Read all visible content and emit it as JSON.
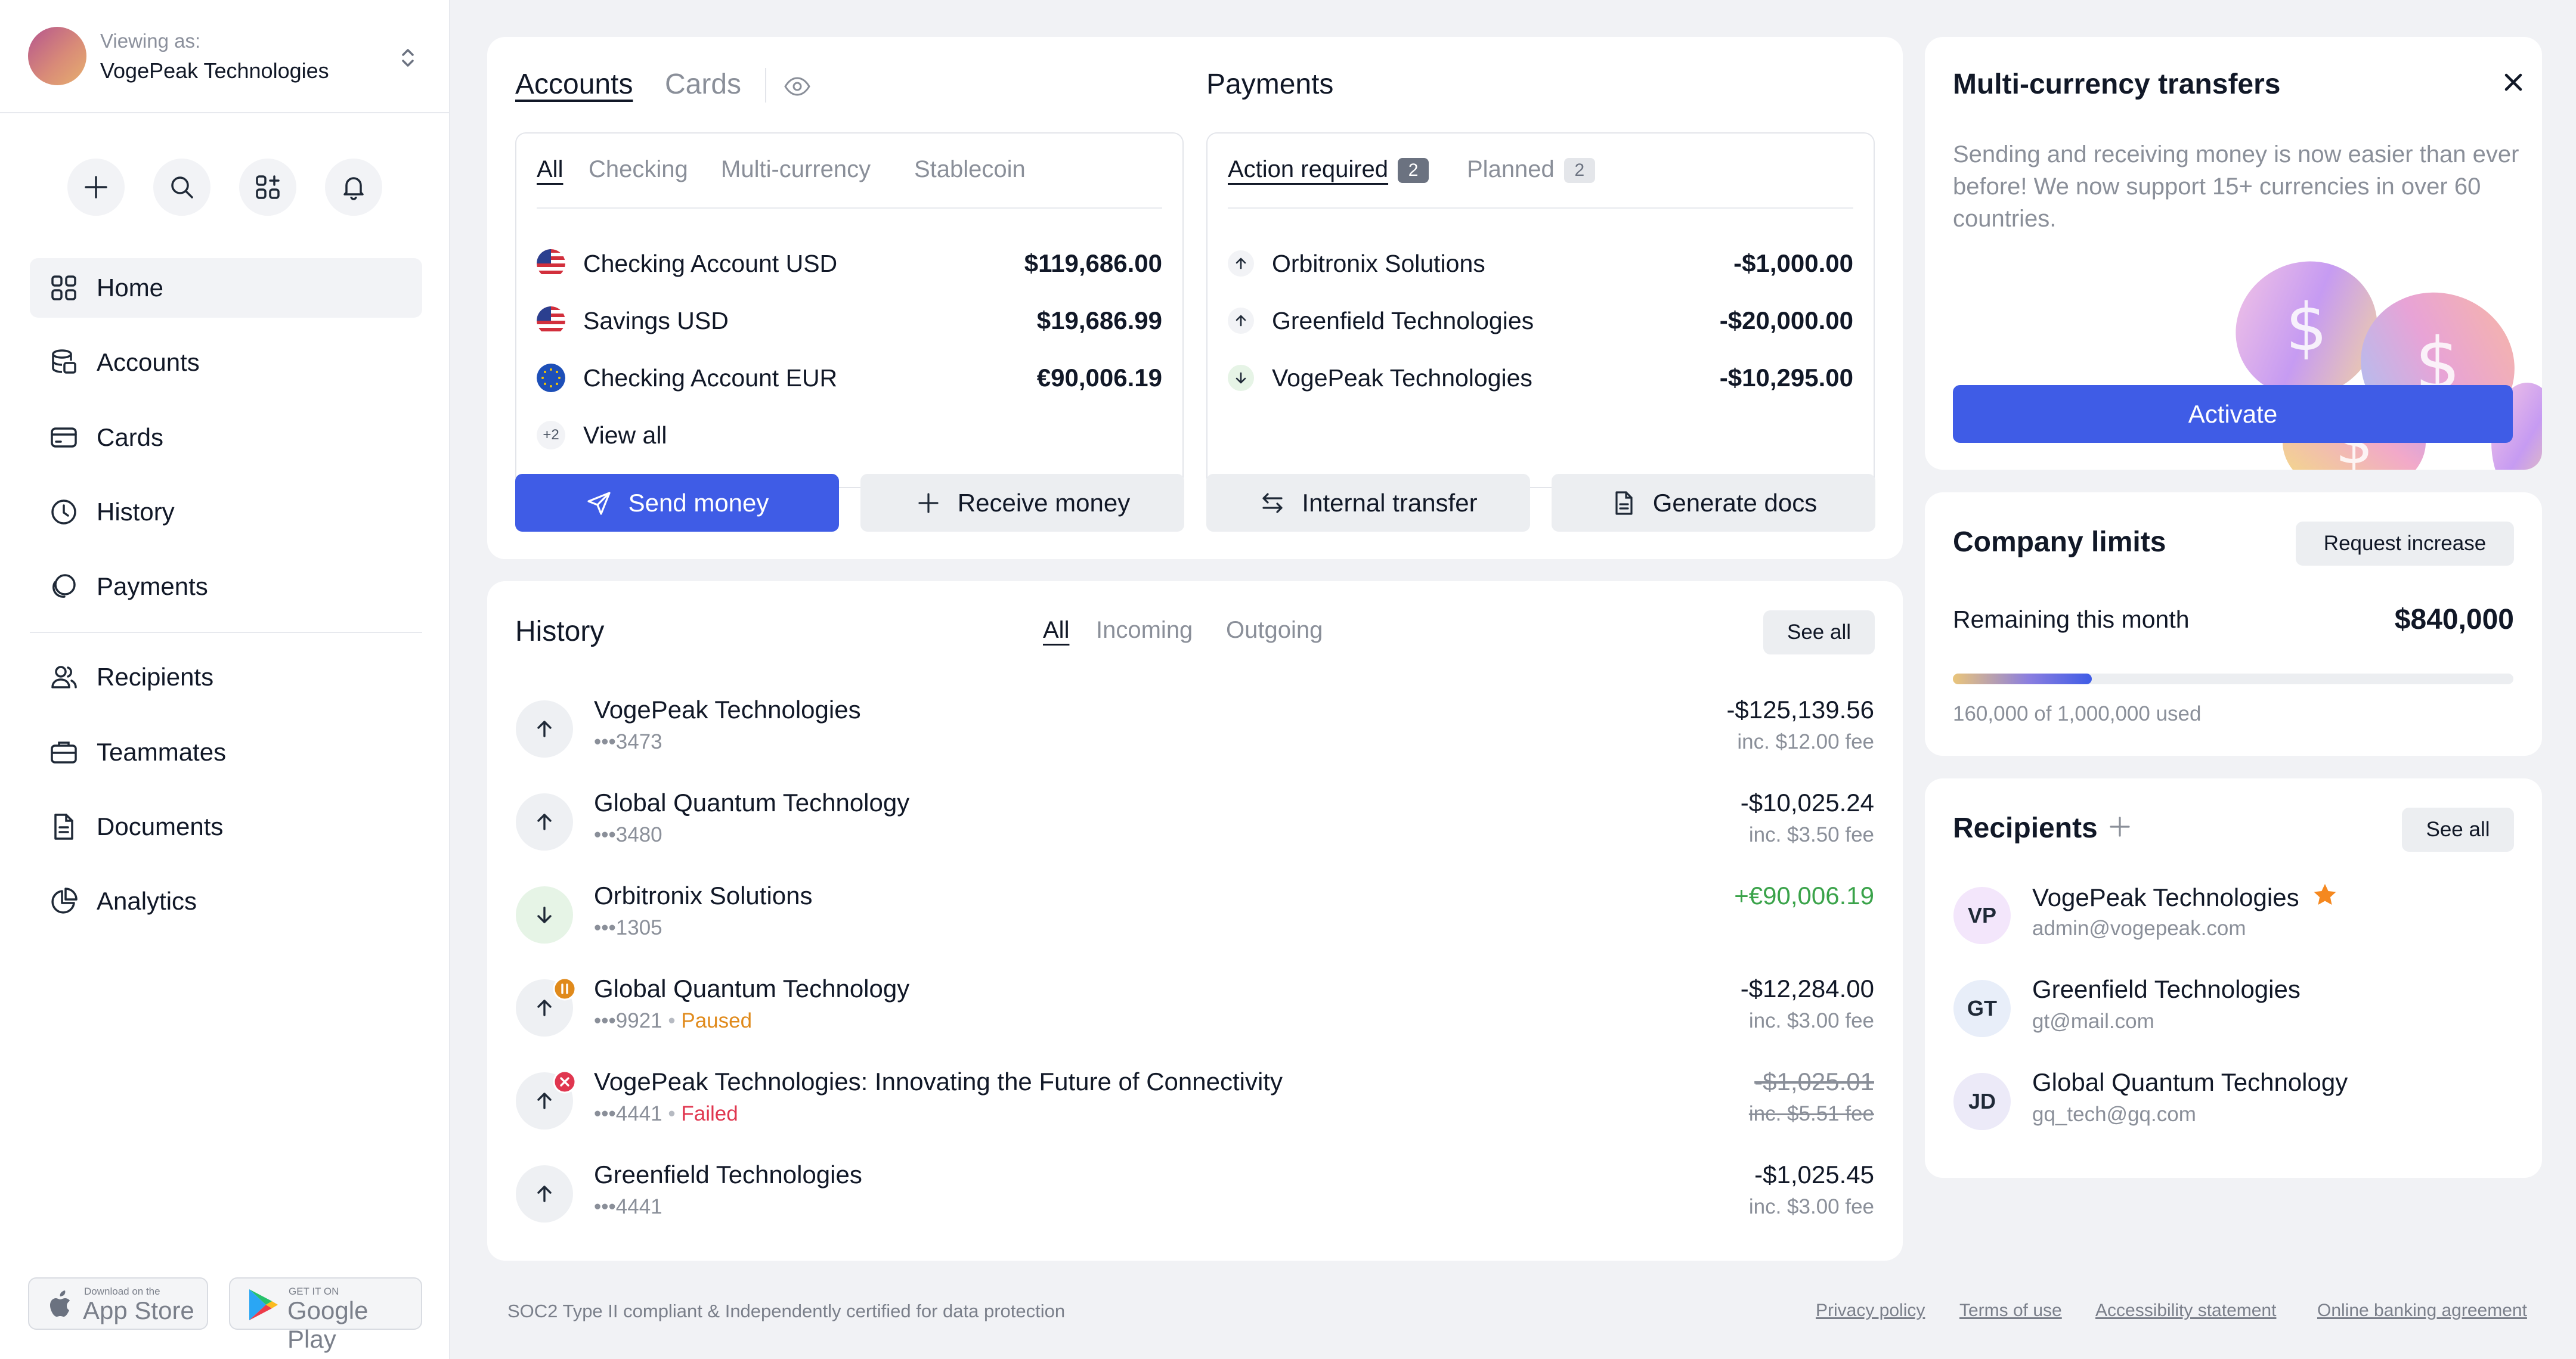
{
  "workspace": {
    "viewing_label": "Viewing as:",
    "org_name": "VogePeak Technologies"
  },
  "quick_actions": [
    {
      "icon": "plus-icon"
    },
    {
      "icon": "search-icon"
    },
    {
      "icon": "apps-add-icon"
    },
    {
      "icon": "bell-icon"
    }
  ],
  "nav": {
    "items": [
      {
        "label": "Home",
        "icon": "grid-icon",
        "active": true
      },
      {
        "label": "Accounts",
        "icon": "database-icon"
      },
      {
        "label": "Cards",
        "icon": "card-icon"
      },
      {
        "label": "History",
        "icon": "clock-icon"
      },
      {
        "label": "Payments",
        "icon": "payments-icon"
      },
      {
        "label": "Recipients",
        "icon": "users-icon"
      },
      {
        "label": "Teammates",
        "icon": "briefcase-icon"
      },
      {
        "label": "Documents",
        "icon": "document-icon"
      },
      {
        "label": "Analytics",
        "icon": "pie-chart-icon"
      }
    ]
  },
  "stores": {
    "appstore_small": "Download on the",
    "appstore_big": "App Store",
    "play_small": "GET IT ON",
    "play_big": "Google Play"
  },
  "accounts_card": {
    "tab_accounts": "Accounts",
    "tab_cards": "Cards",
    "filters": [
      "All",
      "Checking",
      "Multi-currency",
      "Stablecoin"
    ],
    "rows": [
      {
        "name": "Checking Account USD",
        "amount": "$119,686.00",
        "flag": "us"
      },
      {
        "name": "Savings USD",
        "amount": "$19,686.99",
        "flag": "us"
      },
      {
        "name": "Checking Account EUR",
        "amount": "€90,006.19",
        "flag": "eu"
      }
    ],
    "more_count": "+2",
    "view_all": "View all"
  },
  "payments_card": {
    "title": "Payments",
    "tab_required": "Action required",
    "tab_required_count": "2",
    "tab_planned": "Planned",
    "tab_planned_count": "2",
    "rows": [
      {
        "name": "Orbitronix Solutions",
        "amount": "-$1,000.00",
        "direction": "out"
      },
      {
        "name": "Greenfield Technologies",
        "amount": "-$20,000.00",
        "direction": "out"
      },
      {
        "name": "VogePeak Technologies",
        "amount": "-$10,295.00",
        "direction": "in"
      }
    ]
  },
  "actions": {
    "send": "Send money",
    "receive": "Receive money",
    "internal": "Internal transfer",
    "docs": "Generate docs"
  },
  "history": {
    "title": "History",
    "filters": [
      "All",
      "Incoming",
      "Outgoing"
    ],
    "see_all": "See all",
    "rows": [
      {
        "name": "VogePeak Technologies",
        "account": "•••3473",
        "amount": "-$125,139.56",
        "fee": "inc. $12.00 fee",
        "direction": "out"
      },
      {
        "name": "Global Quantum Technology",
        "account": "•••3480",
        "amount": "-$10,025.24",
        "fee": "inc. $3.50 fee",
        "direction": "out"
      },
      {
        "name": "Orbitronix Solutions",
        "account": "•••1305",
        "amount": "+€90,006.19",
        "fee": "",
        "direction": "in"
      },
      {
        "name": "Global Quantum Technology",
        "account": "•••9921",
        "status": "Paused",
        "amount": "-$12,284.00",
        "fee": "inc. $3.00 fee",
        "direction": "out"
      },
      {
        "name": "VogePeak Technologies: Innovating the Future of Connectivity",
        "account": "•••4441",
        "status": "Failed",
        "amount": "-$1,025.01",
        "fee": "inc. $5.51 fee",
        "direction": "out"
      },
      {
        "name": "Greenfield Technologies",
        "account": "•••4441",
        "amount": "-$1,025.45",
        "fee": "inc. $3.00 fee",
        "direction": "out"
      }
    ]
  },
  "promo": {
    "title": "Multi-currency transfers",
    "body": "Sending and receiving money is now easier than ever before! We now support 15+ currencies in over 60 countries.",
    "cta": "Activate"
  },
  "limits": {
    "title": "Company limits",
    "request": "Request increase",
    "remaining_label": "Remaining this month",
    "remaining_value": "$840,000",
    "used_text": "160,000 of 1,000,000 used",
    "used_fraction": 0.16
  },
  "recipients": {
    "title": "Recipients",
    "see_all": "See all",
    "rows": [
      {
        "initials": "VP",
        "name": "VogePeak Technologies",
        "email": "admin@vogepeak.com",
        "starred": true
      },
      {
        "initials": "GT",
        "name": "Greenfield Technologies",
        "email": "gt@mail.com"
      },
      {
        "initials": "JD",
        "name": "Global Quantum Technology",
        "email": "gq_tech@gq.com"
      }
    ]
  },
  "footer": {
    "compliance": "SOC2 Type II compliant & Independently certified for data protection",
    "links": [
      "Privacy policy",
      "Terms of use",
      "Accessibility statement",
      "Online banking agreement"
    ]
  },
  "colors": {
    "primary": "#3f5ce6",
    "incoming": "#3aa34a",
    "paused": "#e08a1b",
    "failed": "#e0364f",
    "star": "#f5881f"
  }
}
